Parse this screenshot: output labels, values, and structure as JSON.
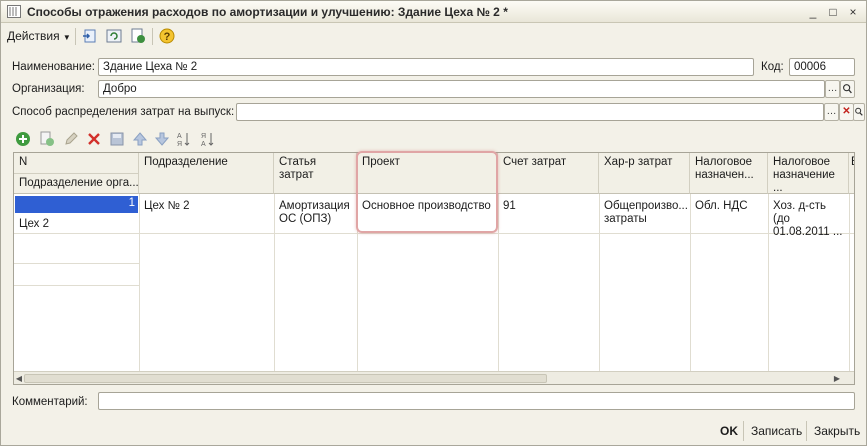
{
  "window": {
    "title": "Способы отражения расходов по амортизации и улучшению: Здание Цеха № 2 *",
    "controls": [
      "_",
      "□",
      "×"
    ]
  },
  "toolbar": {
    "actions_label": "Действия",
    "icons": [
      "open-icon",
      "refresh-icon",
      "save-copy-icon",
      "help-icon"
    ]
  },
  "form": {
    "name_label": "Наименование:",
    "name_value": "Здание Цеха № 2",
    "code_label": "Код:",
    "code_value": "00006",
    "org_label": "Организация:",
    "org_value": "Добро",
    "method_label": "Способ распределения затрат на выпуск:",
    "method_value": "",
    "comment_label": "Комментарий:",
    "comment_value": ""
  },
  "table": {
    "columns": {
      "n": "N",
      "subdivision_sub": "Подразделение орга...",
      "subdivision": "Подразделение",
      "cost_item": "Статья затрат",
      "project": "Проект",
      "cost_account": "Счет затрат",
      "cost_nature": "Хар-р затрат",
      "tax_purpose": "Налоговое назначен...",
      "tax_purpose2": "Налоговое назначение ...",
      "more": "В"
    },
    "rows": [
      {
        "n": "1",
        "org_subdivision": "Цех 2",
        "subdivision": "Цех № 2",
        "cost_item": "Амортизация ОС (ОПЗ)",
        "project": "Основное производство",
        "cost_account": "91",
        "cost_nature": "Общепроизво... затраты",
        "tax_purpose": "Обл. НДС",
        "tax_purpose2": "Хоз. д-сть (до 01.08.2011 ..."
      }
    ]
  },
  "buttons": {
    "ok": "OK",
    "save": "Записать",
    "close": "Закрыть"
  },
  "colors": {
    "selection": "#2f5fd3",
    "highlight_border": "#e0a5a5",
    "window_bg": "#f3f1e8"
  }
}
